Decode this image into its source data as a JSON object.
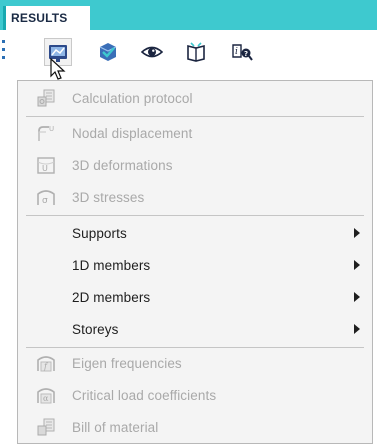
{
  "ribbon": {
    "active_tab": "RESULTS",
    "accent_color": "#3ec9cf"
  },
  "toolbar": {
    "buttons": [
      {
        "icon": "results-view-icon",
        "active": true
      },
      {
        "icon": "check-model-icon",
        "active": false
      },
      {
        "icon": "eye-icon",
        "active": false
      },
      {
        "icon": "book-icon",
        "active": false
      },
      {
        "icon": "info-search-icon",
        "active": false
      }
    ]
  },
  "menu": {
    "items": [
      {
        "label": "Calculation protocol",
        "icon": "calculation-protocol-icon",
        "enabled": false,
        "submenu": false
      },
      {
        "label": "Nodal displacement",
        "icon": "nodal-displacement-icon",
        "enabled": false,
        "submenu": false
      },
      {
        "label": "3D deformations",
        "icon": "3d-deformations-icon",
        "enabled": false,
        "submenu": false
      },
      {
        "label": "3D stresses",
        "icon": "3d-stresses-icon",
        "enabled": false,
        "submenu": false
      },
      {
        "label": "Supports",
        "icon": "",
        "enabled": true,
        "submenu": true
      },
      {
        "label": "1D members",
        "icon": "",
        "enabled": true,
        "submenu": true
      },
      {
        "label": "2D members",
        "icon": "",
        "enabled": true,
        "submenu": true
      },
      {
        "label": "Storeys",
        "icon": "",
        "enabled": true,
        "submenu": true
      },
      {
        "label": "Eigen frequencies",
        "icon": "eigen-frequencies-icon",
        "enabled": false,
        "submenu": false
      },
      {
        "label": "Critical load coefficients",
        "icon": "critical-load-coefficients-icon",
        "enabled": false,
        "submenu": false
      },
      {
        "label": "Bill of material",
        "icon": "bill-of-material-icon",
        "enabled": false,
        "submenu": false
      }
    ]
  }
}
